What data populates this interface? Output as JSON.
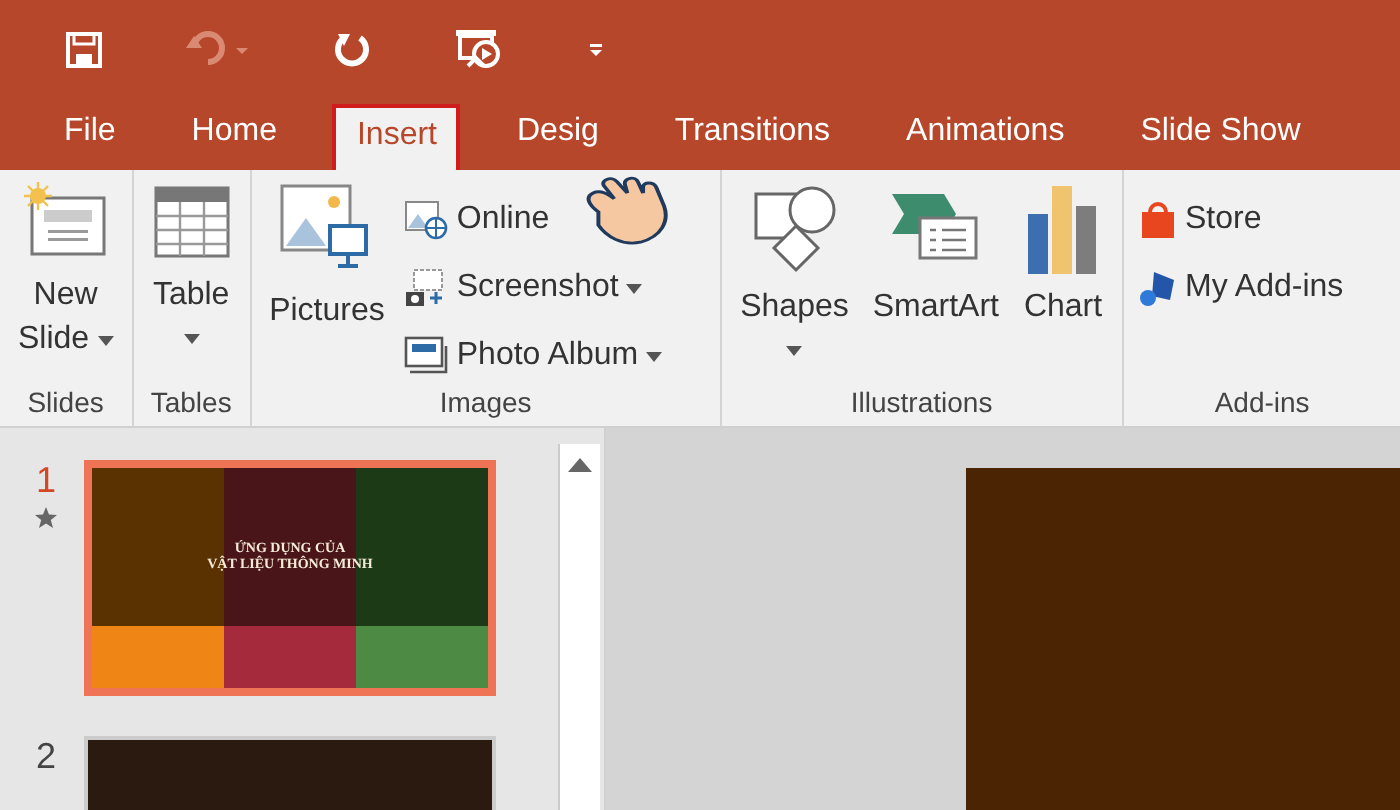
{
  "quick_access": [
    {
      "kind": "save",
      "disabled": false
    },
    {
      "kind": "undo",
      "disabled": true
    },
    {
      "kind": "repeat",
      "disabled": false
    },
    {
      "kind": "present",
      "disabled": false
    },
    {
      "kind": "customize",
      "disabled": false
    }
  ],
  "tabs": [
    {
      "label": "File",
      "selected": false
    },
    {
      "label": "Home",
      "selected": false
    },
    {
      "label": "Insert",
      "selected": true
    },
    {
      "label": "Desig",
      "selected": false
    },
    {
      "label": "Transitions",
      "selected": false
    },
    {
      "label": "Animations",
      "selected": false
    },
    {
      "label": "Slide Show",
      "selected": false
    }
  ],
  "ribbon": {
    "groups": [
      {
        "label": "Slides",
        "commands": [
          {
            "kind": "large",
            "lines": [
              "New",
              "Slide"
            ],
            "dropdown": true
          }
        ]
      },
      {
        "label": "Tables",
        "commands": [
          {
            "kind": "large",
            "lines": [
              "Table"
            ],
            "dropdown": true
          }
        ]
      },
      {
        "label": "Images",
        "commands": [
          {
            "kind": "large",
            "lines": [
              "Pictures"
            ],
            "dropdown": false
          },
          {
            "kind": "stack",
            "items": [
              {
                "label": "Online",
                "dropdown": false
              },
              {
                "label": "Screenshot",
                "dropdown": true
              },
              {
                "label": "Photo Album",
                "dropdown": true
              }
            ]
          }
        ]
      },
      {
        "label": "Illustrations",
        "commands": [
          {
            "kind": "large",
            "lines": [
              "Shapes"
            ],
            "dropdown": true
          },
          {
            "kind": "large",
            "lines": [
              "SmartArt"
            ],
            "dropdown": false
          },
          {
            "kind": "large",
            "lines": [
              "Chart"
            ],
            "dropdown": false
          }
        ]
      },
      {
        "label": "Add-ins",
        "commands": [
          {
            "kind": "stack",
            "items": [
              {
                "label": "Store",
                "dropdown": false
              },
              {
                "label": "My Add-ins",
                "dropdown": false
              }
            ]
          }
        ]
      }
    ]
  },
  "slides": [
    {
      "number": "1",
      "selected": true,
      "animated": true,
      "title": [
        "ỨNG DỤNG CỦA",
        "VẬT LIỆU THÔNG MINH"
      ]
    },
    {
      "number": "2",
      "selected": false,
      "animated": false
    }
  ]
}
